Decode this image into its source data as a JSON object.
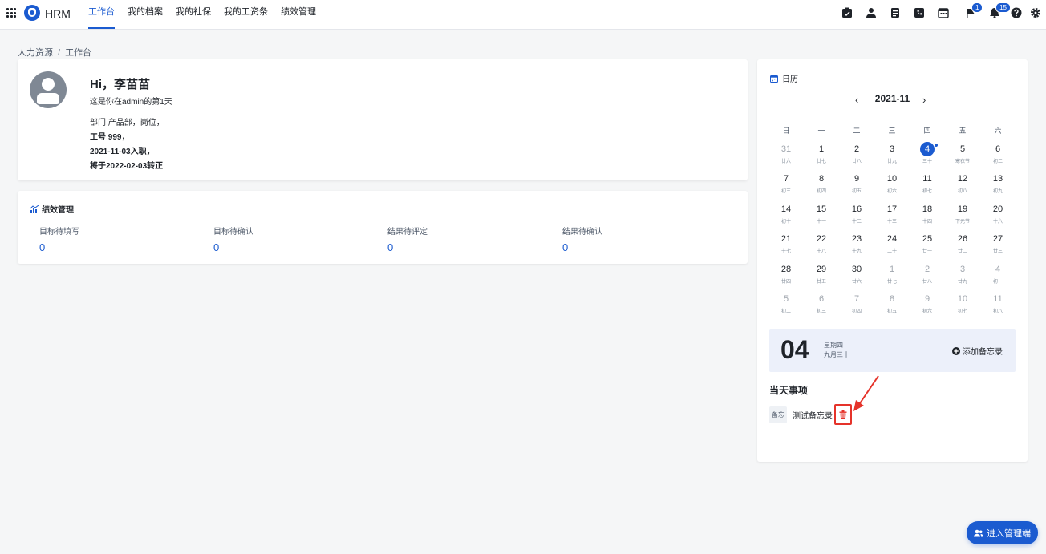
{
  "app": {
    "name": "HRM"
  },
  "nav": [
    {
      "label": "工作台",
      "active": true
    },
    {
      "label": "我的档案"
    },
    {
      "label": "我的社保"
    },
    {
      "label": "我的工资条"
    },
    {
      "label": "绩效管理"
    }
  ],
  "badges": {
    "flag": "1",
    "bell": "15"
  },
  "breadcrumb": {
    "root": "人力资源",
    "sep": "/",
    "current": "工作台"
  },
  "profile": {
    "greeting": "Hi，李苗苗",
    "days_text": "这是你在admin的第1天",
    "dept": "部门 产品部，岗位，",
    "emp_no": "工号 999，",
    "joined": "2021-11-03入职，",
    "regular": "将于2022-02-03转正"
  },
  "performance": {
    "title": "绩效管理",
    "stats": [
      {
        "label": "目标待填写",
        "value": "0"
      },
      {
        "label": "目标待确认",
        "value": "0"
      },
      {
        "label": "结果待评定",
        "value": "0"
      },
      {
        "label": "结果待确认",
        "value": "0"
      }
    ]
  },
  "calendar": {
    "title": "日历",
    "month": "2021-11",
    "weekdays": [
      "日",
      "一",
      "二",
      "三",
      "四",
      "五",
      "六"
    ],
    "days": [
      {
        "d": "31",
        "l": "廿六",
        "other": true
      },
      {
        "d": "1",
        "l": "廿七"
      },
      {
        "d": "2",
        "l": "廿八"
      },
      {
        "d": "3",
        "l": "廿九"
      },
      {
        "d": "4",
        "l": "三十",
        "today": true
      },
      {
        "d": "5",
        "l": "寒衣节"
      },
      {
        "d": "6",
        "l": "初二"
      },
      {
        "d": "7",
        "l": "初三"
      },
      {
        "d": "8",
        "l": "初四"
      },
      {
        "d": "9",
        "l": "初五"
      },
      {
        "d": "10",
        "l": "初六"
      },
      {
        "d": "11",
        "l": "初七"
      },
      {
        "d": "12",
        "l": "初八"
      },
      {
        "d": "13",
        "l": "初九"
      },
      {
        "d": "14",
        "l": "初十"
      },
      {
        "d": "15",
        "l": "十一"
      },
      {
        "d": "16",
        "l": "十二"
      },
      {
        "d": "17",
        "l": "十三"
      },
      {
        "d": "18",
        "l": "十四"
      },
      {
        "d": "19",
        "l": "下元节"
      },
      {
        "d": "20",
        "l": "十六"
      },
      {
        "d": "21",
        "l": "十七"
      },
      {
        "d": "22",
        "l": "十八"
      },
      {
        "d": "23",
        "l": "十九"
      },
      {
        "d": "24",
        "l": "二十"
      },
      {
        "d": "25",
        "l": "廿一"
      },
      {
        "d": "26",
        "l": "廿二"
      },
      {
        "d": "27",
        "l": "廿三"
      },
      {
        "d": "28",
        "l": "廿四"
      },
      {
        "d": "29",
        "l": "廿五"
      },
      {
        "d": "30",
        "l": "廿六"
      },
      {
        "d": "1",
        "l": "廿七",
        "other": true
      },
      {
        "d": "2",
        "l": "廿八",
        "other": true
      },
      {
        "d": "3",
        "l": "廿九",
        "other": true
      },
      {
        "d": "4",
        "l": "初一",
        "other": true
      },
      {
        "d": "5",
        "l": "初二",
        "other": true
      },
      {
        "d": "6",
        "l": "初三",
        "other": true
      },
      {
        "d": "7",
        "l": "初四",
        "other": true
      },
      {
        "d": "8",
        "l": "初五",
        "other": true
      },
      {
        "d": "9",
        "l": "初六",
        "other": true
      },
      {
        "d": "10",
        "l": "初七",
        "other": true
      },
      {
        "d": "11",
        "l": "初八",
        "other": true
      }
    ],
    "selected": {
      "day": "04",
      "weekday": "星期四",
      "lunar": "九月三十"
    },
    "add_memo": "添加备忘录",
    "today_title": "当天事项",
    "memo": {
      "tag": "备忘",
      "text": "测试备忘录"
    }
  },
  "admin_button": "进入管理端",
  "colors": {
    "primary": "#1b5bd0",
    "danger": "#e5332a"
  }
}
